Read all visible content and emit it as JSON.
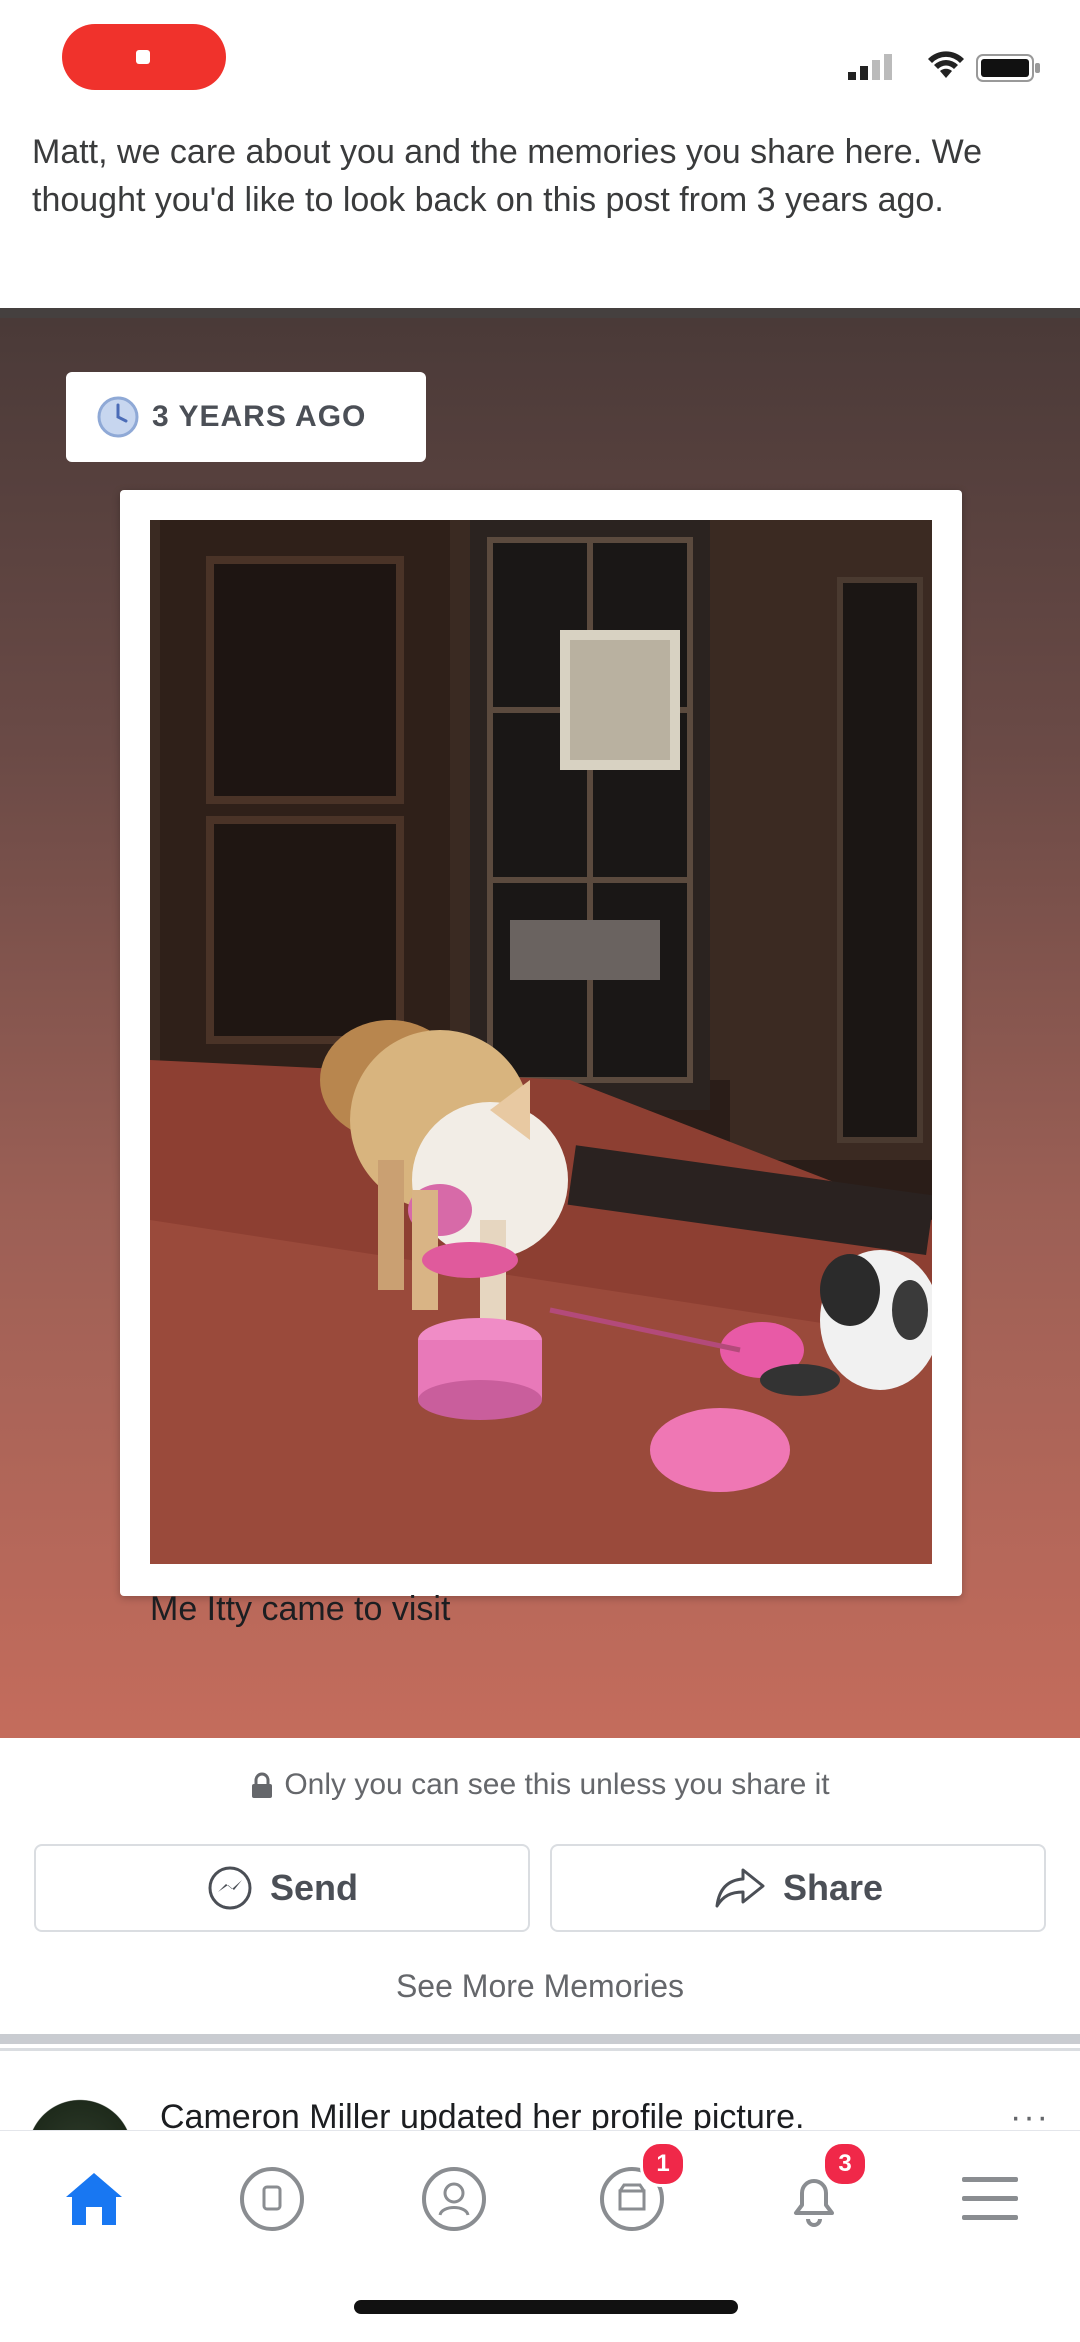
{
  "status_bar": {
    "recording_color": "#f0322c"
  },
  "memory": {
    "intro": "Matt, we care about you and the memories you share here. We thought you'd like to look back on this post from 3 years ago.",
    "badge_label": "3 YEARS AGO",
    "caption": "Me Itty came to visit",
    "privacy_note": "Only you can see this unless you share it",
    "send_label": "Send",
    "share_label": "Share",
    "see_more_label": "See More Memories"
  },
  "next_story": {
    "text": "Cameron Miller updated her profile picture.",
    "more_label": "···"
  },
  "tab_bar": {
    "tabs": [
      {
        "name": "home",
        "icon": "home-icon",
        "badge": ""
      },
      {
        "name": "watch",
        "icon": "watch-icon",
        "badge": ""
      },
      {
        "name": "profile",
        "icon": "profile-icon",
        "badge": ""
      },
      {
        "name": "marketplace",
        "icon": "marketplace-icon",
        "badge": "1"
      },
      {
        "name": "notifications",
        "icon": "bell-icon",
        "badge": "3"
      },
      {
        "name": "menu",
        "icon": "menu-icon",
        "badge": ""
      }
    ]
  },
  "colors": {
    "accent": "#1877f2",
    "badge": "#f02849"
  }
}
